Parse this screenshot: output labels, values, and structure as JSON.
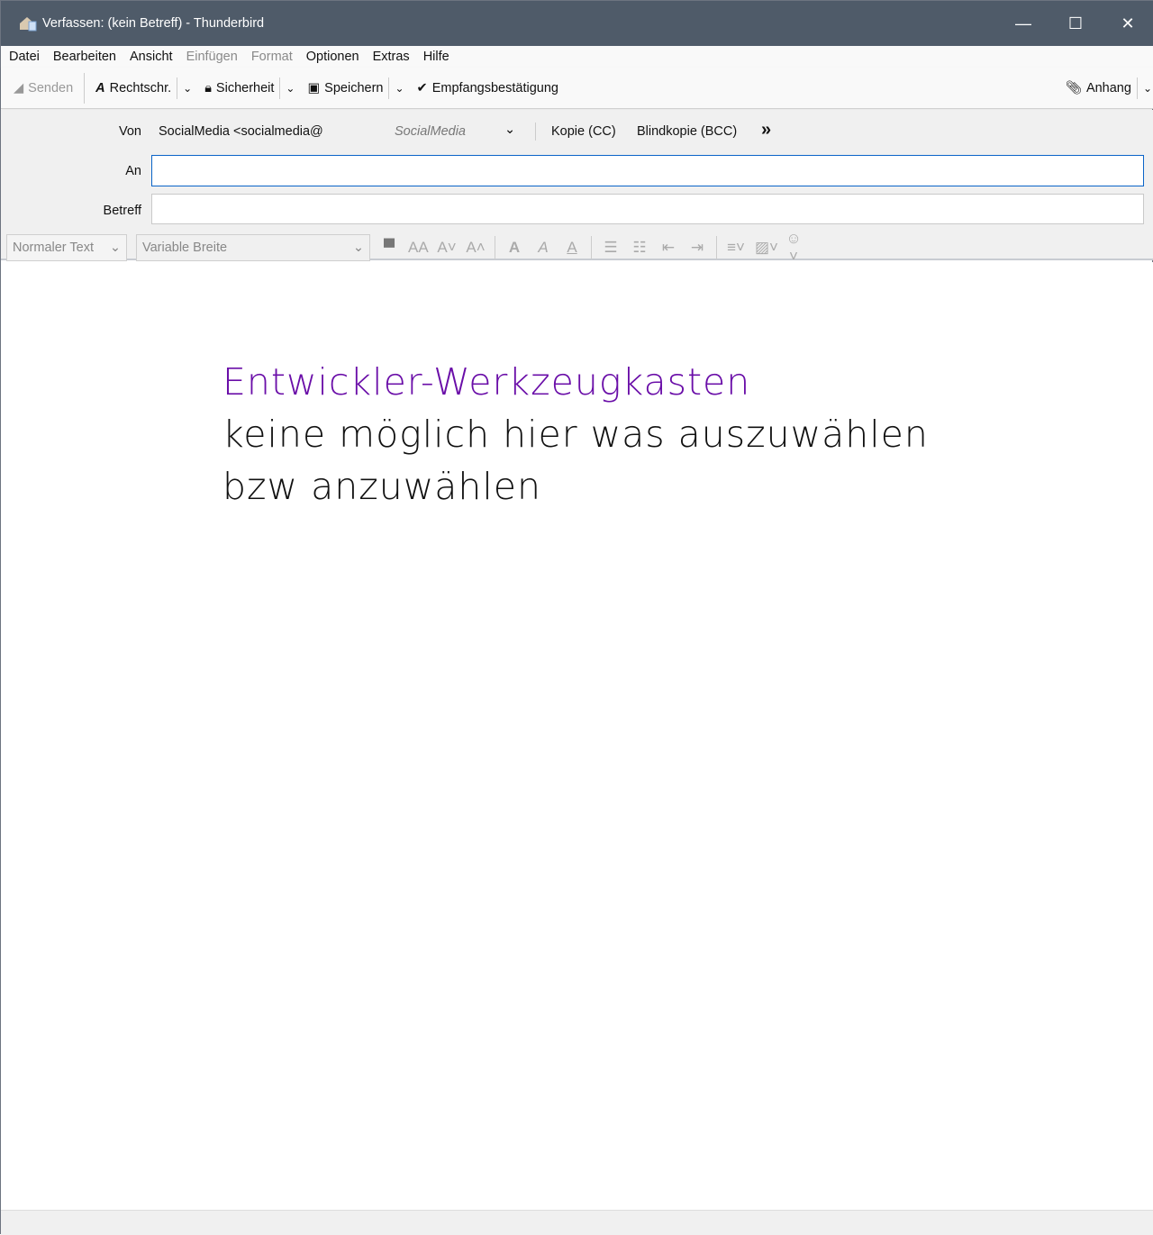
{
  "window": {
    "title": "Verfassen: (kein Betreff) - Thunderbird",
    "minimize": "—",
    "maximize": "☐",
    "close": "✕"
  },
  "menu": [
    {
      "label": "Datei",
      "enabled": true
    },
    {
      "label": "Bearbeiten",
      "enabled": true
    },
    {
      "label": "Ansicht",
      "enabled": true
    },
    {
      "label": "Einfügen",
      "enabled": false
    },
    {
      "label": "Format",
      "enabled": false
    },
    {
      "label": "Optionen",
      "enabled": true
    },
    {
      "label": "Extras",
      "enabled": true
    },
    {
      "label": "Hilfe",
      "enabled": true
    }
  ],
  "toolbar": {
    "send": "Senden",
    "spell": "Rechtschr.",
    "security": "Sicherheit",
    "save": "Speichern",
    "receipt": "Empfangsbestätigung",
    "attach": "Anhang"
  },
  "header": {
    "from_label": "Von",
    "from_value": "SocialMedia <socialmedia@",
    "from_identity": "SocialMedia",
    "cc": "Kopie (CC)",
    "bcc": "Blindkopie (BCC)",
    "to_label": "An",
    "to_value": "",
    "subject_label": "Betreff",
    "subject_value": ""
  },
  "format": {
    "paragraph": "Normaler Text",
    "font": "Variable Breite"
  },
  "body": {
    "heading": "Entwickler-Werkzeugkasten",
    "line1": "keine möglich hier was auszuwählen",
    "line2": "bzw anzuwählen",
    "heading_color": "#6a0ea8"
  }
}
